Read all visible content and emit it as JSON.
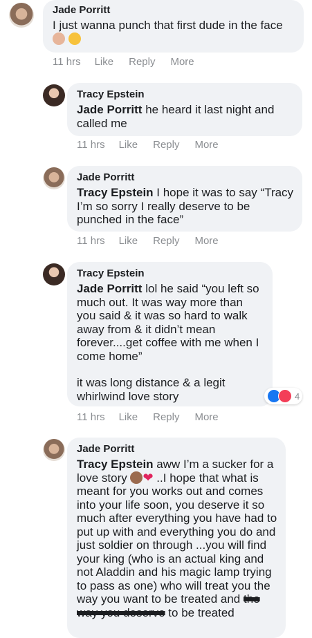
{
  "actions": {
    "like": "Like",
    "reply": "Reply",
    "more": "More"
  },
  "comments": [
    {
      "author": "Jade Porritt",
      "text": "I just wanna punch that first dude in the face",
      "time": "11 hrs"
    },
    {
      "author": "Tracy Epstein",
      "mention": "Jade Porritt",
      "text": " he heard it last night and called me",
      "time": "11 hrs"
    },
    {
      "author": "Jade Porritt",
      "mention": "Tracy Epstein",
      "text": " I hope it was to say “Tracy I’m so sorry I really deserve to be punched in the face”",
      "time": "11 hrs"
    },
    {
      "author": "Tracy Epstein",
      "mention": "Jade Porritt",
      "text": " lol he said “you left so much out. It was way more than you said & it was so hard to walk away from & it didn’t mean forever....get coffee with me when I come home”",
      "text2": "it was long distance & a legit whirlwind love story",
      "reactions_count": "4",
      "time": "11 hrs"
    },
    {
      "author": "Jade Porritt",
      "mention": "Tracy Epstein",
      "text_a": " aww I’m a sucker for a love story ",
      "text_b": " ..I hope that what is meant for you works out and comes into your life soon, you deserve it so much after everything you have had to put up with and everything you do and just soldier on through ...you will find your king (who is an actual king and not Aladdin and his magic lamp trying to pass as one) who will treat you the way you want to be treated and ",
      "struck": "the way you deserve",
      "text_c": " to be treated"
    }
  ]
}
